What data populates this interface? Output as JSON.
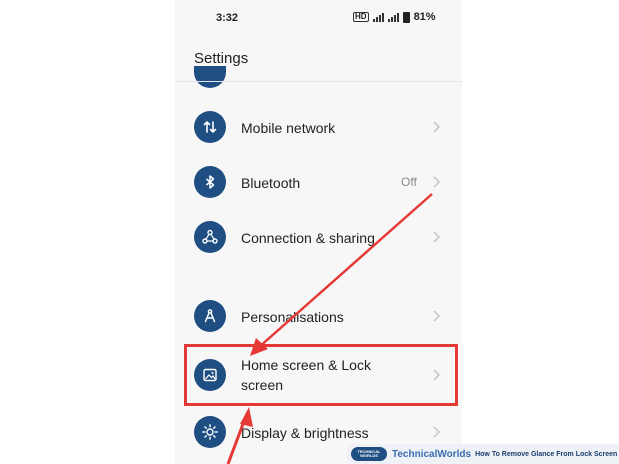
{
  "status_bar": {
    "time": "3:32",
    "network_badge": "HD",
    "battery": "81%"
  },
  "header": {
    "title": "Settings"
  },
  "items": [
    {
      "label": "Mobile network",
      "value": "",
      "icon": "arrows-up-down-icon"
    },
    {
      "label": "Bluetooth",
      "value": "Off",
      "icon": "bluetooth-icon"
    },
    {
      "label": "Connection & sharing",
      "value": "",
      "icon": "connection-icon"
    },
    {
      "label": "Personalisations",
      "value": "",
      "icon": "compass-icon"
    },
    {
      "label_line1": "Home screen & Lock",
      "label_line2": "screen",
      "value": "",
      "icon": "image-icon"
    },
    {
      "label": "Display & brightness",
      "value": "",
      "icon": "sun-icon"
    }
  ],
  "annotation": {
    "highlight_color": "#e53935"
  },
  "watermark": {
    "logo_text": "TECHNICAL WORLDS",
    "brand": "TechnicalWorlds",
    "caption": "How To Remove Glance From Lock Screen"
  },
  "colors": {
    "icon_bg": "#1f4f82",
    "background": "#f7f7f7",
    "value_text": "#888888"
  }
}
